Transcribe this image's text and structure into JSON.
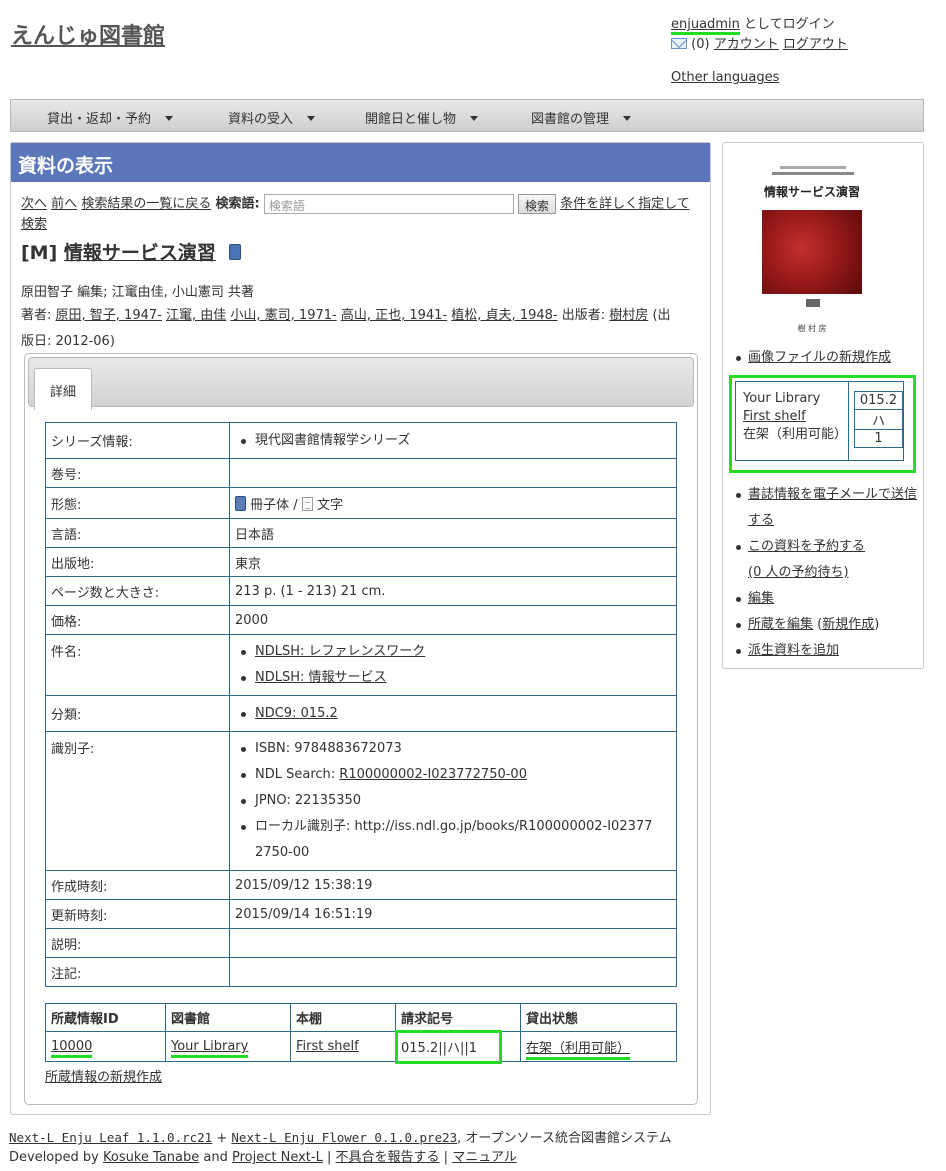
{
  "site": {
    "title": "えんじゅ図書館"
  },
  "login": {
    "username": "enjuadmin",
    "logged_in_suffix": "としてログイン",
    "message_count": "(0)",
    "account_link": "アカウント",
    "logout_link": "ログアウト",
    "other_languages": "Other languages"
  },
  "menu": {
    "items": [
      {
        "label": "貸出・返却・予約"
      },
      {
        "label": "資料の受入"
      },
      {
        "label": "開館日と催し物"
      },
      {
        "label": "図書館の管理"
      }
    ]
  },
  "main": {
    "header": "資料の表示",
    "nav": {
      "next": "次へ",
      "prev": "前へ",
      "back_to_results": "検索結果の一覧に戻る",
      "search_label": "検索語:",
      "search_placeholder": "検索語",
      "search_button": "検索",
      "advanced_1": "条件を詳しく指定して",
      "advanced_2": "検索"
    },
    "book": {
      "type_prefix": "[M]",
      "title": "情報サービス演習",
      "creators_line": "原田智子 編集; 江竃由佳, 小山憲司 共著",
      "authors_label": "著者:",
      "authors": [
        "原田, 智子, 1947-",
        "江竃, 由佳",
        "小山, 憲司, 1971-",
        "高山, 正也, 1941-",
        "植松, 貞夫, 1948-"
      ],
      "publisher_label": "出版者:",
      "publisher": "樹村房",
      "pub_date_1": "(出",
      "pub_date_2": "版日: 2012-06)"
    },
    "tab_label": "詳細",
    "details": {
      "series_label": "シリーズ情報:",
      "series_value": "現代図書館情報学シリーズ",
      "volume_label": "巻号:",
      "form_label": "形態:",
      "form_carrier": "冊子体",
      "form_sep": "/",
      "form_content": "文字",
      "language_label": "言語:",
      "language_value": "日本語",
      "place_label": "出版地:",
      "place_value": "東京",
      "pages_label": "ページ数と大きさ:",
      "pages_value": "213 p. (1 - 213) 21 cm.",
      "price_label": "価格:",
      "price_value": "2000",
      "subject_label": "件名:",
      "subjects": [
        "NDLSH: レファレンスワーク",
        "NDLSH: 情報サービス"
      ],
      "class_label": "分類:",
      "class_value": "NDC9: 015.2",
      "id_label": "識別子:",
      "isbn": "ISBN: 9784883672073",
      "ndl_search_prefix": "NDL Search:",
      "ndl_search_link": "R100000002-I023772750-00",
      "jpno": "JPNO: 22135350",
      "local_id_1": "ローカル識別子: http://iss.ndl.go.jp/books/R100000002-I02377",
      "local_id_2": "2750-00",
      "created_label": "作成時刻:",
      "created_value": "2015/09/12 15:38:19",
      "updated_label": "更新時刻:",
      "updated_value": "2015/09/14 16:51:19",
      "desc_label": "説明:",
      "note_label": "注記:"
    },
    "holdings": {
      "headers": [
        "所蔵情報ID",
        "図書館",
        "本棚",
        "請求記号",
        "貸出状態"
      ],
      "row": {
        "id": "10000",
        "library": "Your Library",
        "shelf": "First shelf",
        "call_number": "015.2||ハ||1",
        "status": "在架（利用可能）"
      },
      "new_link": "所蔵情報の新規作成"
    }
  },
  "sidebar": {
    "cover": {
      "top_text": "現代図書館情報学シリーズ",
      "title": "情報サービス演習",
      "publisher": "樹 村 房"
    },
    "new_image": "画像ファイルの新規作成",
    "library_name": "Your Library",
    "shelf_name": "First shelf",
    "status": "在架（利用可能）",
    "call_parts": [
      "015.2",
      "ハ",
      "1"
    ],
    "email_1": "書誌情報を電子メールで送信",
    "email_2": "する",
    "reserve_1": "この資料を予約する",
    "reserve_2": "(0 人の予約待ち)",
    "edit": "編集",
    "holding_edit": "所蔵を編集",
    "holding_new": "新規作成",
    "derived": "派生資料を追加"
  },
  "footer": {
    "leaf": "Next-L Enju Leaf 1.1.0.rc21",
    "plus": "+",
    "flower": "Next-L Enju Flower 0.1.0.pre23",
    "tagline": ", オープンソース統合図書館システム",
    "developed_by": "Developed by",
    "dev_name": "Kosuke Tanabe",
    "and": "and",
    "project": "Project Next-L",
    "sep": "|",
    "report": "不具合を報告する",
    "manual": "マニュアル"
  }
}
